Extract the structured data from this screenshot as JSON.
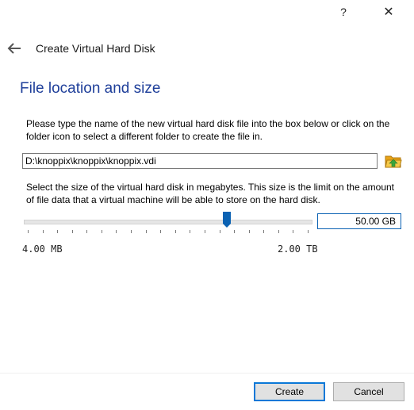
{
  "titlebar": {
    "help_glyph": "?",
    "close_glyph": "✕"
  },
  "header": {
    "title": "Create Virtual Hard Disk"
  },
  "section": {
    "title": "File location and size"
  },
  "location": {
    "description": "Please type the name of the new virtual hard disk file into the box below or click on the folder icon to select a different folder to create the file in.",
    "path_value": "D:\\knoppix\\knoppix\\knoppix.vdi",
    "folder_icon": "folder-open-icon"
  },
  "size": {
    "description": "Select the size of the virtual hard disk in megabytes. This size is the limit on the amount of file data that a virtual machine will be able to store on the hard disk.",
    "value": "50.00 GB",
    "min_label": "4.00 MB",
    "max_label": "2.00 TB"
  },
  "buttons": {
    "create": "Create",
    "cancel": "Cancel"
  },
  "colors": {
    "section_title": "#1f3f9a",
    "accent": "#0a78d7",
    "slider_handle": "#0b62b3"
  }
}
